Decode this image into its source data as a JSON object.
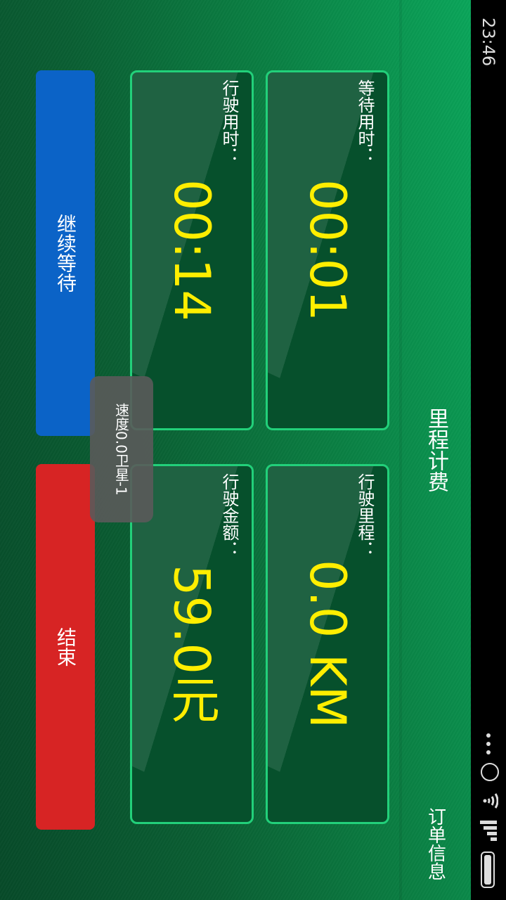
{
  "status_bar": {
    "time": "23:46"
  },
  "header": {
    "title": "里程计费",
    "order_info": "订单信息"
  },
  "cards": [
    {
      "label": "等待用时：",
      "value": "00:01"
    },
    {
      "label": "行驶里程：",
      "value": "0.0 KM"
    },
    {
      "label": "行驶用时：",
      "value": "00:14"
    },
    {
      "label": "行驶金额：",
      "value": "59.0元"
    }
  ],
  "buttons": {
    "continue_wait": "继续等待",
    "end": "结束"
  },
  "toast": {
    "text": "速度0.0卫星-1"
  },
  "colors": {
    "accent_yellow": "#ffee00",
    "card_border": "#22d07a",
    "blue": "#0b63c7",
    "red": "#d72424"
  }
}
